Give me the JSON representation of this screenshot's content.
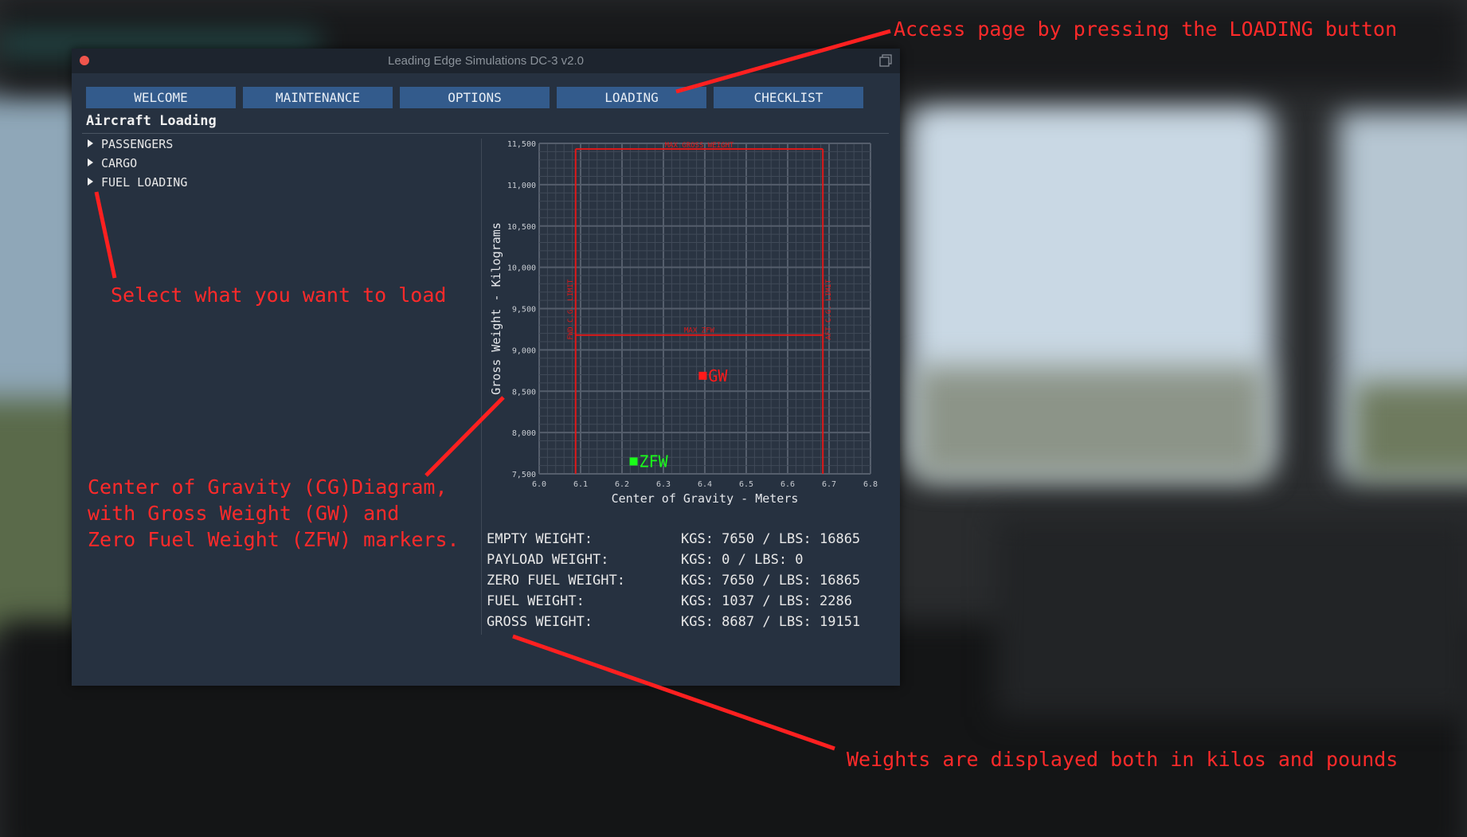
{
  "window": {
    "title": "Leading Edge Simulations DC-3 v2.0"
  },
  "tabs": [
    {
      "label": "WELCOME"
    },
    {
      "label": "MAINTENANCE"
    },
    {
      "label": "OPTIONS"
    },
    {
      "label": "LOADING"
    },
    {
      "label": "CHECKLIST"
    }
  ],
  "page": {
    "heading": "Aircraft Loading"
  },
  "tree": [
    {
      "label": "PASSENGERS"
    },
    {
      "label": "CARGO"
    },
    {
      "label": "FUEL LOADING"
    }
  ],
  "weights": [
    {
      "label": "EMPTY WEIGHT:",
      "value": "KGS: 7650 / LBS: 16865"
    },
    {
      "label": "PAYLOAD WEIGHT:",
      "value": "KGS: 0 / LBS: 0"
    },
    {
      "label": "ZERO FUEL WEIGHT:",
      "value": "KGS: 7650 / LBS: 16865"
    },
    {
      "label": "FUEL WEIGHT:",
      "value": "KGS: 1037 / LBS: 2286"
    },
    {
      "label": "GROSS WEIGHT:",
      "value": "KGS: 8687 / LBS: 19151"
    }
  ],
  "chart_data": {
    "type": "scatter",
    "title": "",
    "xlabel": "Center of Gravity - Meters",
    "ylabel": "Gross Weight - Kilograms",
    "xlim": [
      6.0,
      6.8
    ],
    "ylim": [
      7500,
      11500
    ],
    "x_ticks": [
      "6.0",
      "6.1",
      "6.2",
      "6.3",
      "6.4",
      "6.5",
      "6.6",
      "6.7",
      "6.8"
    ],
    "y_ticks": [
      "7,500",
      "8,000",
      "8,500",
      "9,000",
      "9,500",
      "10,000",
      "10,500",
      "11,000",
      "11,500"
    ],
    "x_tick_values": [
      6.0,
      6.1,
      6.2,
      6.3,
      6.4,
      6.5,
      6.6,
      6.7,
      6.8
    ],
    "y_tick_values": [
      7500,
      8000,
      8500,
      9000,
      9500,
      10000,
      10500,
      11000,
      11500
    ],
    "grid": true,
    "limits": {
      "fwd_cg": {
        "value": 6.088,
        "label": "FWD C.G. LIMIT"
      },
      "aft_cg": {
        "value": 6.685,
        "label": "AFT C.G. LIMIT"
      },
      "max_gross": {
        "value": 11431,
        "label": "MAX GROSS WEIGHT"
      },
      "max_zfw": {
        "value": 9180,
        "label": "MAX ZFW"
      }
    },
    "points": [
      {
        "name": "GW",
        "x": 6.395,
        "y": 8687,
        "color": "#ff1a1a"
      },
      {
        "name": "ZFW",
        "x": 6.228,
        "y": 7650,
        "color": "#1aff1a"
      }
    ]
  },
  "annotations": {
    "access": "Access page by pressing the LOADING button",
    "select": "Select what you want to load",
    "cg_line1": "Center of Gravity (CG)Diagram,",
    "cg_line2": "with Gross Weight (GW) and",
    "cg_line3": "Zero Fuel Weight (ZFW) markers.",
    "weights": "Weights are displayed both in kilos and pounds"
  },
  "colors": {
    "accent": "#335b8c",
    "panel": "#263140",
    "annotation": "#ff2a2a"
  }
}
